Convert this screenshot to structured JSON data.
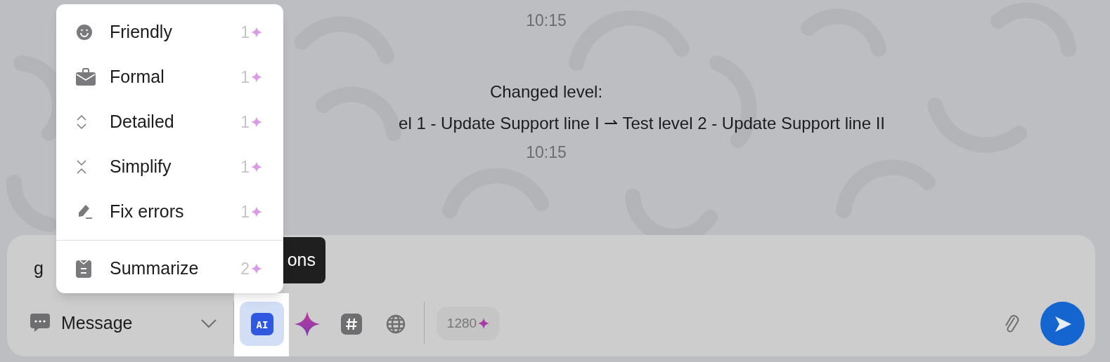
{
  "chat": {
    "events": [
      {
        "kind": "time",
        "text": "10:15"
      },
      {
        "kind": "title",
        "text": "Changed level:"
      },
      {
        "kind": "detail",
        "text": "el 1 - Update Support line I ⇀ Test level 2 - Update Support line II"
      },
      {
        "kind": "time",
        "text": "10:15"
      }
    ]
  },
  "menu": {
    "groups": [
      [
        {
          "label": "Friendly",
          "cost": "1",
          "kind": "smile"
        },
        {
          "label": "Formal",
          "cost": "1",
          "kind": "briefcase"
        },
        {
          "label": "Detailed",
          "cost": "1",
          "kind": "expand"
        },
        {
          "label": "Simplify",
          "cost": "1",
          "kind": "collapse"
        },
        {
          "label": "Fix errors",
          "cost": "1",
          "kind": "eraser"
        }
      ],
      [
        {
          "label": "Summarize",
          "cost": "2",
          "kind": "clipboard"
        }
      ]
    ]
  },
  "composer": {
    "value": "g",
    "tooltip": "ons",
    "mode": "Message",
    "tools": [
      {
        "kind": "ai",
        "label": "AI",
        "selected": true
      },
      {
        "kind": "sparkle",
        "selected": false
      },
      {
        "kind": "hash",
        "selected": false
      },
      {
        "kind": "globe",
        "selected": false
      }
    ],
    "credits": "1280"
  }
}
